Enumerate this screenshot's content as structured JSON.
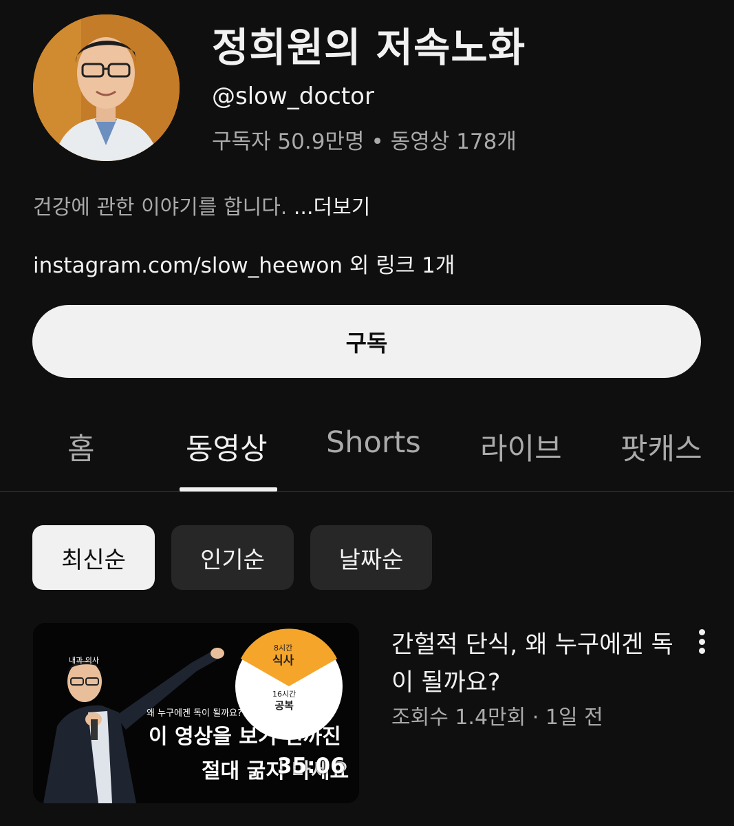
{
  "channel": {
    "name": "정희원의 저속노화",
    "handle": "@slow_doctor",
    "subscribers": "구독자 50.9만명",
    "separator": "•",
    "videos_count": "동영상 178개",
    "description": "건강에 관한 이야기를 합니다. ",
    "more_label": "...더보기",
    "links_text": "instagram.com/slow_heewon 외 링크 1개"
  },
  "subscribe_label": "구독",
  "tabs": [
    {
      "label": "홈"
    },
    {
      "label": "동영상"
    },
    {
      "label": "Shorts"
    },
    {
      "label": "라이브"
    },
    {
      "label": "팟캐스"
    }
  ],
  "active_tab": "동영상",
  "sort_chips": [
    {
      "label": "최신순",
      "selected": true
    },
    {
      "label": "인기순",
      "selected": false
    },
    {
      "label": "날짜순",
      "selected": false
    }
  ],
  "video": {
    "title": "간헐적 단식, 왜 누구에겐 독이 될까요?",
    "meta": "조회수 1.4만회 · 1일 전",
    "duration": "35:06",
    "thumbnail": {
      "label": "내과 의사",
      "subcaption": "왜 누구에겐 독이 될까요?",
      "caption_line1": "이 영상을 보기 전까진",
      "caption_line2": "절대 굶지 마세요",
      "pie_top_small": "8시간",
      "pie_top": "식사",
      "pie_bottom_small": "16시간",
      "pie_bottom": "공복"
    }
  },
  "colors": {
    "background": "#0f0f0f",
    "text_primary": "#f1f1f1",
    "text_secondary": "#aaaaaa",
    "chip_bg": "#272727",
    "pie_orange": "#f5a52a"
  },
  "icons": [
    "more-vert-icon"
  ]
}
